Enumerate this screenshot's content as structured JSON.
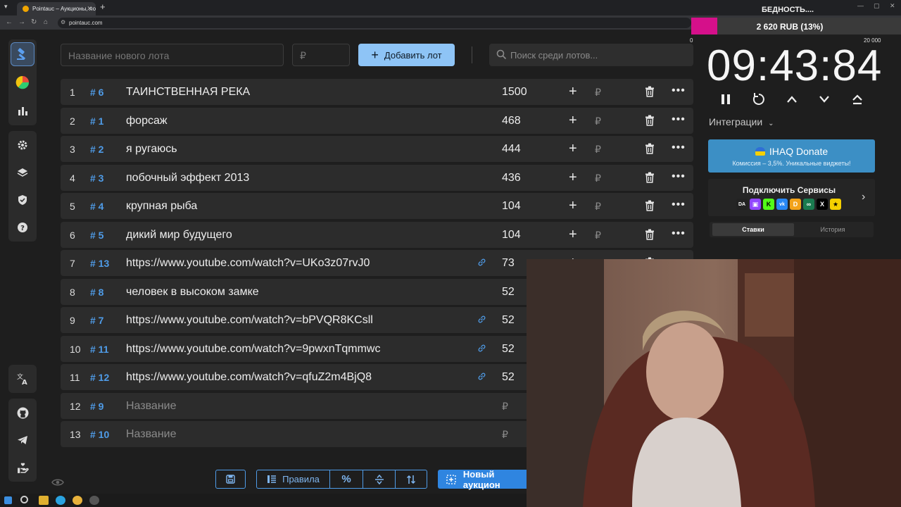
{
  "browser": {
    "tab_title": "Pointauc – Аукционы, лотереи",
    "url": "pointauc.com"
  },
  "top": {
    "lot_name_placeholder": "Название нового лота",
    "price_placeholder": "₽",
    "add_button": "Добавить лот",
    "search_placeholder": "Поиск среди лотов..."
  },
  "lots": [
    {
      "n": "1",
      "id": "# 6",
      "name": "ТАИНСТВЕННАЯ РЕКА",
      "amount": "1500",
      "link": false,
      "placeholder": false
    },
    {
      "n": "2",
      "id": "# 1",
      "name": "форсаж",
      "amount": "468",
      "link": false,
      "placeholder": false
    },
    {
      "n": "3",
      "id": "# 2",
      "name": "я ругаюсь",
      "amount": "444",
      "link": false,
      "placeholder": false
    },
    {
      "n": "4",
      "id": "# 3",
      "name": "побочный эффект 2013",
      "amount": "436",
      "link": false,
      "placeholder": false
    },
    {
      "n": "5",
      "id": "# 4",
      "name": "крупная рыба",
      "amount": "104",
      "link": false,
      "placeholder": false
    },
    {
      "n": "6",
      "id": "# 5",
      "name": "дикий мир будущего",
      "amount": "104",
      "link": false,
      "placeholder": false
    },
    {
      "n": "7",
      "id": "# 13",
      "name": "https://www.youtube.com/watch?v=UKo3z07rvJ0",
      "amount": "73",
      "link": true,
      "placeholder": false
    },
    {
      "n": "8",
      "id": "# 8",
      "name": "человек в высоком замке",
      "amount": "52",
      "link": false,
      "placeholder": false
    },
    {
      "n": "9",
      "id": "# 7",
      "name": "https://www.youtube.com/watch?v=bPVQR8KCsll",
      "amount": "52",
      "link": true,
      "placeholder": false
    },
    {
      "n": "10",
      "id": "# 11",
      "name": "https://www.youtube.com/watch?v=9pwxnTqmmwc",
      "amount": "52",
      "link": true,
      "placeholder": false
    },
    {
      "n": "11",
      "id": "# 12",
      "name": "https://www.youtube.com/watch?v=qfuZ2m4BjQ8",
      "amount": "52",
      "link": true,
      "placeholder": false
    },
    {
      "n": "12",
      "id": "# 9",
      "name": "Название",
      "amount": "",
      "link": false,
      "placeholder": true
    },
    {
      "n": "13",
      "id": "# 10",
      "name": "Название",
      "amount": "",
      "link": false,
      "placeholder": true
    }
  ],
  "row_labels": {
    "rub": "₽",
    "plus": "+",
    "more": "•••"
  },
  "toolbar": {
    "rules": "Правила",
    "new_auction": "Новый аукцион"
  },
  "goal": {
    "title": "БЕДНОСТЬ....",
    "progress_text": "2 620 RUB (13%)",
    "progress_fraction": 0.131,
    "min": "0",
    "max": "20 000",
    "color": "#d5108a"
  },
  "timer": "09:43:84",
  "integrations": {
    "label": "Интеграции",
    "donate_title": "IHAQ Donate",
    "donate_sub": "Комиссия – 3,5%. Уникальные виджеты!",
    "services_title": "Подключить Сервисы"
  },
  "tabs": {
    "bets": "Ставки",
    "history": "История"
  },
  "colors": {
    "accent": "#4f9ce8",
    "add_button": "#8ec4f6",
    "donate": "#3c8fc5"
  }
}
